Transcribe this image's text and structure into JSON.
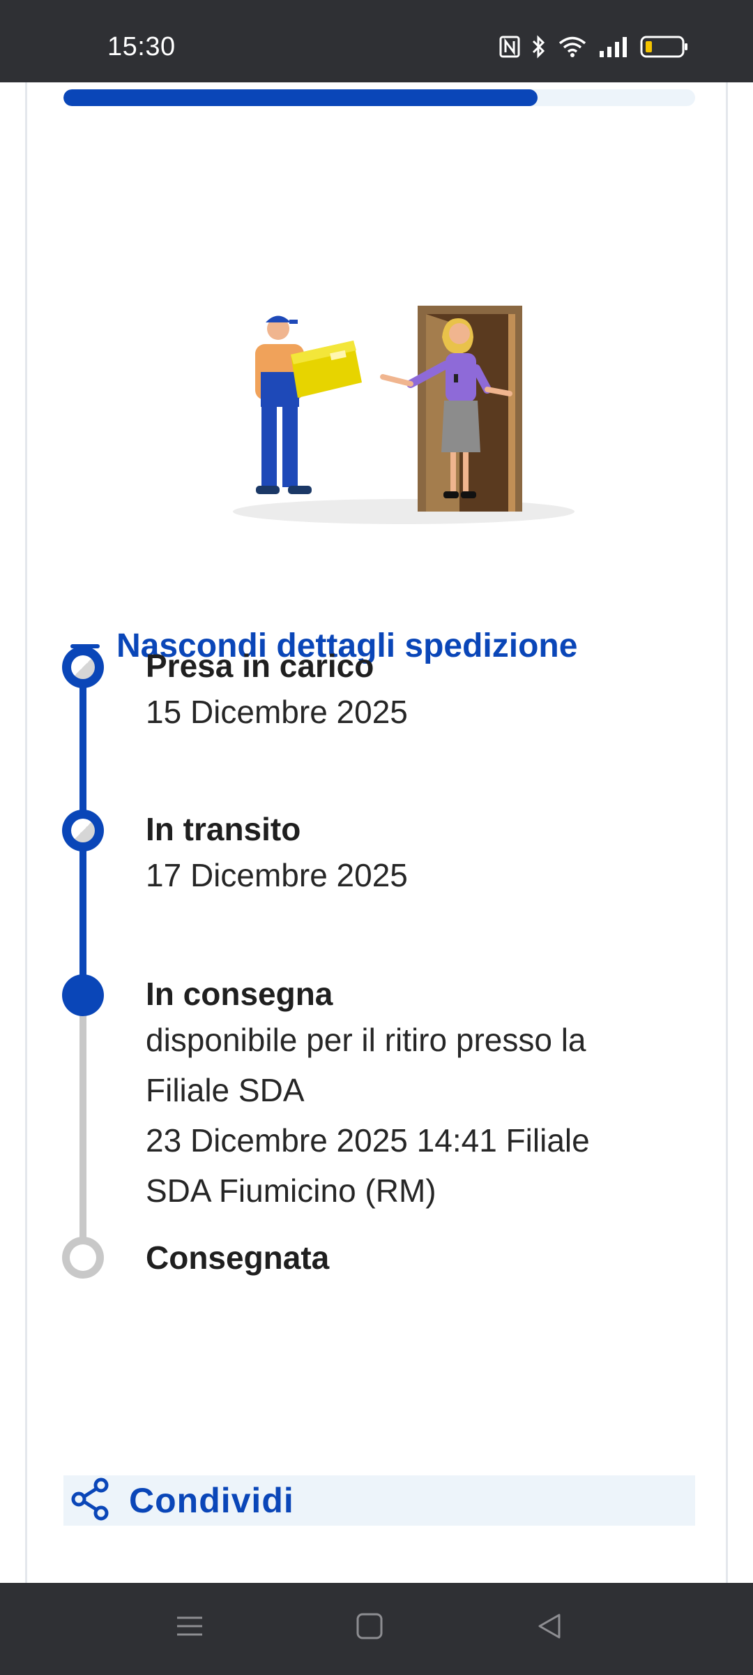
{
  "status_bar": {
    "time": "15:30",
    "icons": [
      "nfc-icon",
      "bluetooth-icon",
      "wifi-icon",
      "signal-icon",
      "battery-icon"
    ]
  },
  "shipment": {
    "progress_percent": 75,
    "toggle_label": "Nascondi dettagli spedizione",
    "steps": [
      {
        "title": "Presa in carico",
        "lines": [
          "15 Dicembre 2025"
        ],
        "state": "done"
      },
      {
        "title": "In transito",
        "lines": [
          "17 Dicembre 2025"
        ],
        "state": "done"
      },
      {
        "title": "In consegna",
        "lines": [
          "disponibile per il ritiro presso la",
          "Filiale SDA",
          "23 Dicembre 2025 14:41 Filiale",
          "SDA Fiumicino (RM)"
        ],
        "state": "current"
      },
      {
        "title": "Consegnata",
        "lines": [],
        "state": "pending"
      }
    ],
    "share_label": "Condividi"
  },
  "colors": {
    "accent": "#0a46b8",
    "pending": "#c8c8c8",
    "share_bg": "#edf4fa",
    "system_bar": "#2f3034"
  },
  "nav_bar": {
    "icons": [
      "menu-icon",
      "home-icon",
      "back-icon"
    ]
  }
}
